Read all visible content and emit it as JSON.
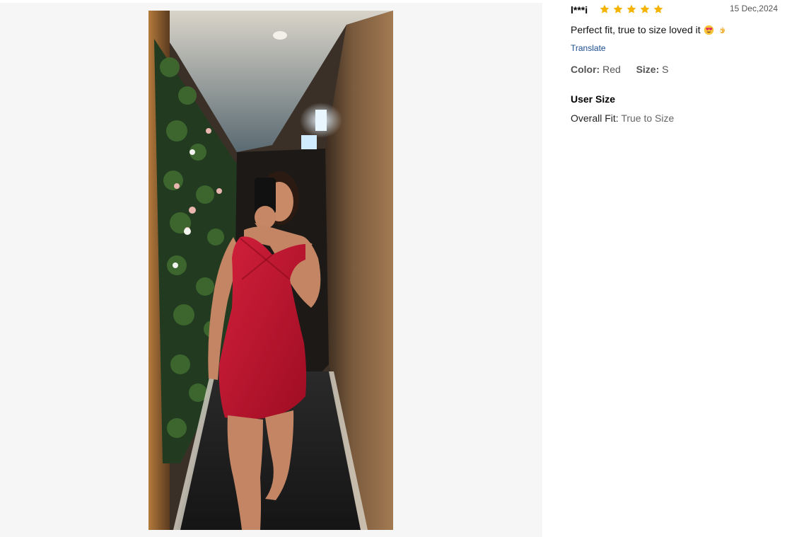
{
  "review": {
    "user": "l***i",
    "rating": 5,
    "date": "15 Dec,2024",
    "comment": "Perfect fit, true to size loved it",
    "comment_emojis": [
      "heart-eyes-emoji",
      "ok-hand-emoji"
    ],
    "translate_label": "Translate",
    "color_label": "Color:",
    "color_value": "Red",
    "size_label": "Size:",
    "size_value": "S",
    "user_size_title": "User Size",
    "overall_fit_label": "Overall Fit:",
    "overall_fit_value": "True to Size"
  },
  "colors": {
    "star": "#f5b301",
    "link": "#1a4d8f",
    "gallery_bg": "#f6f6f6",
    "dress": "#c8102e"
  },
  "icons": {
    "star": "star-icon"
  }
}
